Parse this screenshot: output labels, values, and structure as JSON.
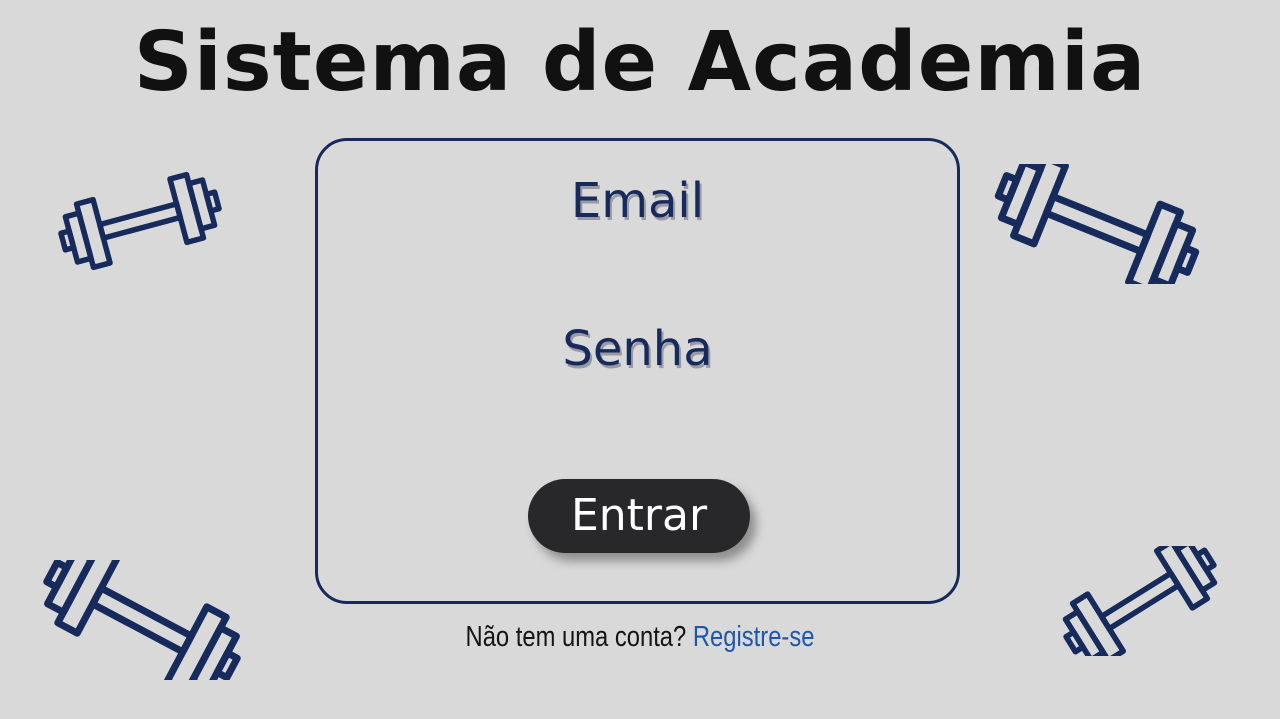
{
  "header": {
    "title": "Sistema de Academia"
  },
  "login_form": {
    "email_label": "Email",
    "password_label": "Senha",
    "submit_label": "Entrar"
  },
  "footer": {
    "register_prompt": "Não tem uma conta?",
    "register_link": "Registre-se"
  },
  "decorations": {
    "icon": "dumbbell-icon",
    "count": 4
  },
  "colors": {
    "background": "#d9d9d9",
    "accent": "#172a5c",
    "button": "#28282b",
    "link": "#1f56a8"
  }
}
